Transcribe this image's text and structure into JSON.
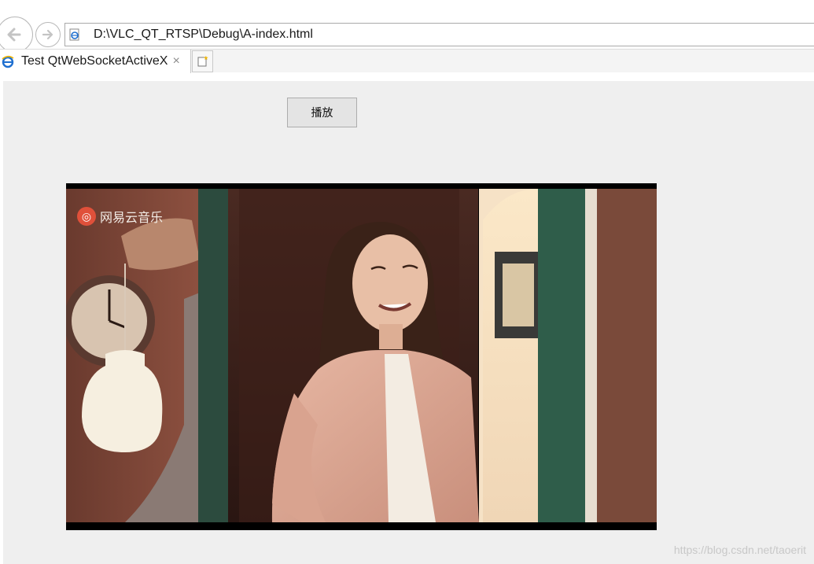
{
  "browser": {
    "address": "D:\\VLC_QT_RTSP\\Debug\\A-index.html",
    "tab_title": "Test QtWebSocketActiveX",
    "tab_close": "×"
  },
  "page": {
    "play_button_label": "播放"
  },
  "video": {
    "logo_text": "网易云音乐"
  },
  "watermark": "https://blog.csdn.net/taoerit",
  "icons": {
    "back": "back-arrow-icon",
    "forward": "forward-arrow-icon",
    "page": "ie-page-icon",
    "tab": "ie-logo-icon",
    "new_tab": "new-tab-icon",
    "logo": "netease-music-logo"
  },
  "colors": {
    "content_bg": "#efefef",
    "button_bg": "#e4e4e4",
    "ie_blue": "#1e6fd0",
    "logo_red": "#e0503a"
  }
}
